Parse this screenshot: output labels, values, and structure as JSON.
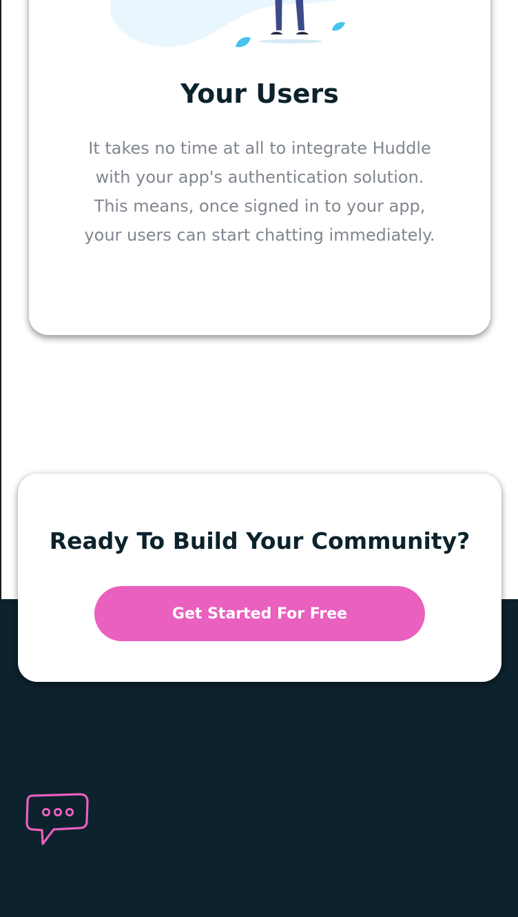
{
  "features": {
    "users": {
      "title": "Your Users",
      "description": "It takes no time at all to integrate Huddle with your app's authentication solution. This means, once signed in to your app, your users can start chatting immediately."
    }
  },
  "cta": {
    "title": "Ready To Build Your Community?",
    "button_label": "Get Started For Free"
  },
  "footer": {
    "logo_icon": "chat-bubble-logo-icon"
  },
  "colors": {
    "accent": "#ea60bf",
    "dark": "#0c222c",
    "body_text": "#80868f",
    "illustration_blob": "#e9f6fd",
    "leaf": "#46c4ee"
  }
}
